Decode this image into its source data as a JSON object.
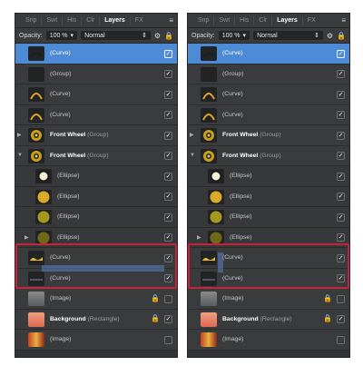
{
  "tabs": [
    "Snp",
    "Swt",
    "His",
    "Clr",
    "Layers",
    "FX"
  ],
  "active_tab": "Layers",
  "opacity_label": "Opacity:",
  "opacity_value": "100 %",
  "blend_mode": "Normal",
  "layers": [
    {
      "name": "(Curve)",
      "bold": "",
      "selected": true,
      "checked": true
    },
    {
      "name": "(Group)",
      "bold": "",
      "checked": true
    },
    {
      "name": "(Curve)",
      "bold": "",
      "checked": true
    },
    {
      "name": "(Curve)",
      "bold": "",
      "checked": true
    },
    {
      "name": "(Group)",
      "bold": "Front Wheel",
      "checked": true,
      "expander": "right"
    },
    {
      "name": "(Group)",
      "bold": "Front Wheel",
      "checked": true,
      "expander": "down"
    },
    {
      "name": "(Ellipse)",
      "bold": "",
      "checked": true
    },
    {
      "name": "(Ellipse)",
      "bold": "",
      "checked": true
    },
    {
      "name": "(Ellipse)",
      "bold": "",
      "checked": true
    },
    {
      "name": "(Ellipse)",
      "bold": "",
      "checked": true,
      "expander": "right"
    },
    {
      "name": "(Curve)",
      "bold": "",
      "checked": true
    },
    {
      "name": "(Curve)",
      "bold": "",
      "checked": true
    },
    {
      "name": "(Image)",
      "bold": "",
      "checked": false,
      "locked": true
    },
    {
      "name": "(Rectangle)",
      "bold": "Background",
      "checked": true,
      "locked": true
    },
    {
      "name": "(Image)",
      "bold": "",
      "checked": false
    }
  ],
  "icons": {
    "check": "✓",
    "lock": "🔒",
    "gear": "⚙",
    "menu": "≡",
    "expander_right": "▶",
    "expander_down": "▼",
    "stepper": "⇕",
    "dropdown": "▾"
  }
}
